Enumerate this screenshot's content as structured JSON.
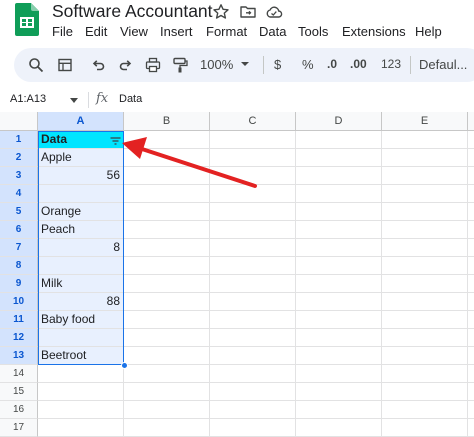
{
  "app": {
    "title": "Software Accountant",
    "menu": [
      "File",
      "Edit",
      "View",
      "Insert",
      "Format",
      "Data",
      "Tools",
      "Extensions",
      "Help"
    ]
  },
  "toolbar": {
    "zoom": "100%",
    "currency": "$",
    "percent": "%",
    "decrease_decimal": ".0",
    "increase_decimal": ".00",
    "more_formats": "123",
    "font": "Defaul..."
  },
  "formula_bar": {
    "range": "A1:A13",
    "fx": "fx",
    "value": "Data"
  },
  "grid": {
    "columns": [
      "A",
      "B",
      "C",
      "D",
      "E"
    ],
    "rows": [
      "1",
      "2",
      "3",
      "4",
      "5",
      "6",
      "7",
      "8",
      "9",
      "10",
      "11",
      "12",
      "13",
      "14",
      "15",
      "16",
      "17"
    ],
    "cells_a": [
      "Data",
      "Apple",
      "56",
      "",
      "Orange",
      "Peach",
      "8",
      "",
      "Milk",
      "88",
      "Baby food",
      "",
      "Beetroot",
      "",
      "",
      "",
      ""
    ]
  },
  "colors": {
    "header_cell": "#00e5ff",
    "selection": "#1a73e8",
    "annotation_arrow": "#e32222"
  }
}
